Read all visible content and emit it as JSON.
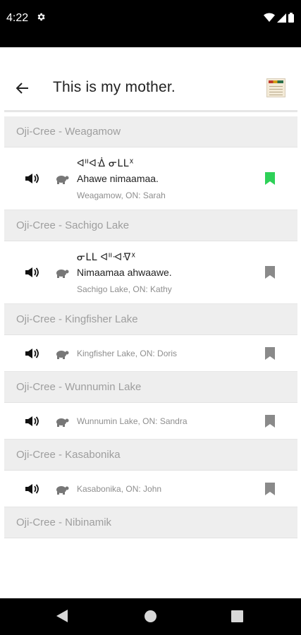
{
  "status_bar": {
    "time": "4:22"
  },
  "app_bar": {
    "title": "This is my mother."
  },
  "colors": {
    "bookmark_active": "#2ed158",
    "bookmark_inactive": "#8a8a8a"
  },
  "sections": [
    {
      "header": "Oji-Cree - Weagamow",
      "syllabics": "ᐊᐦᐊᐐ ᓂᒪᒪᕽ",
      "phrase": "Ahawe nimaamaa.",
      "meta": "Weagamow, ON: Sarah",
      "bookmarked": true
    },
    {
      "header": "Oji-Cree - Sachigo Lake",
      "syllabics": "ᓂᒪᒪ ᐊᐦᐗᐌᕽ",
      "phrase": "Nimaamaa ahwaawe.",
      "meta": "Sachigo Lake, ON: Kathy",
      "bookmarked": false
    },
    {
      "header": "Oji-Cree - Kingfisher Lake",
      "meta": "Kingfisher Lake, ON: Doris",
      "bookmarked": false
    },
    {
      "header": "Oji-Cree - Wunnumin Lake",
      "meta": "Wunnumin Lake, ON: Sandra",
      "bookmarked": false
    },
    {
      "header": "Oji-Cree - Kasabonika",
      "meta": "Kasabonika, ON: John",
      "bookmarked": false
    },
    {
      "header": "Oji-Cree - Nibinamik"
    }
  ]
}
